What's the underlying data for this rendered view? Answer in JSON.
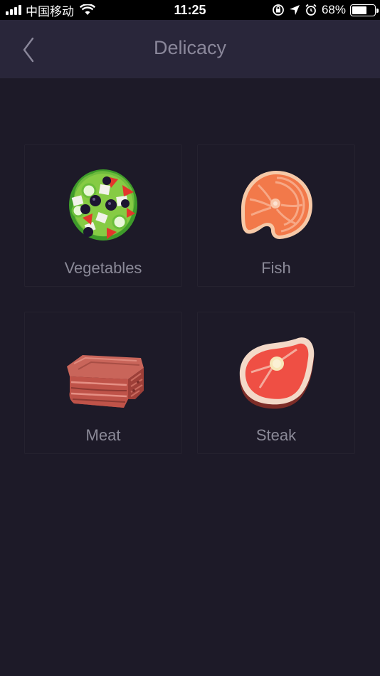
{
  "status_bar": {
    "carrier": "中国移动",
    "time": "11:25",
    "battery_percent": "68%",
    "battery_level": 0.68,
    "icons": [
      "signal-icon",
      "wifi-icon",
      "rotation-lock-icon",
      "location-arrow-icon",
      "alarm-icon",
      "battery-icon"
    ]
  },
  "nav": {
    "title": "Delicacy",
    "back_icon": "chevron-left-icon"
  },
  "categories": [
    {
      "label": "Vegetables",
      "icon": "salad-icon"
    },
    {
      "label": "Fish",
      "icon": "salmon-steak-icon"
    },
    {
      "label": "Meat",
      "icon": "meat-block-icon"
    },
    {
      "label": "Steak",
      "icon": "steak-icon"
    }
  ],
  "colors": {
    "background": "#1d1a28",
    "nav_background": "#29263a",
    "text_muted": "#8b8a98"
  }
}
